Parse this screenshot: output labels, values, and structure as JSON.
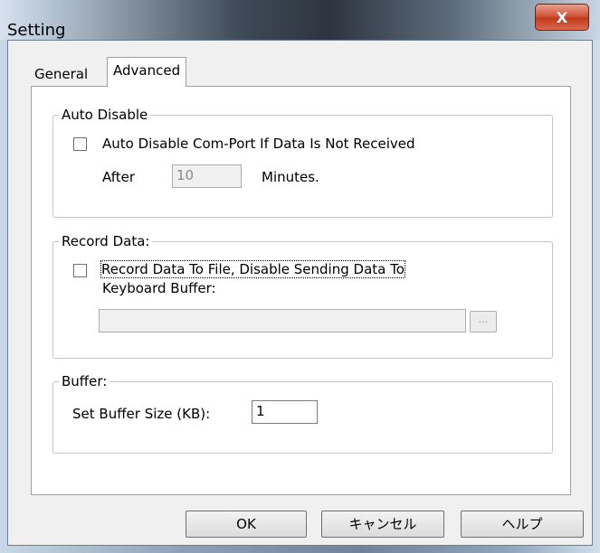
{
  "window": {
    "title": "Setting",
    "close_label": "X"
  },
  "tabs": [
    {
      "label": "General"
    },
    {
      "label": "Advanced"
    }
  ],
  "auto_disable": {
    "legend": "Auto Disable",
    "checkbox_label": "Auto Disable Com-Port If Data Is Not Received",
    "after_label": "After",
    "minutes_value": "10",
    "minutes_label": "Minutes."
  },
  "record_data": {
    "legend": "Record Data:",
    "checkbox_label_line1": "Record Data To File, Disable Sending Data To",
    "checkbox_label_line2": "Keyboard Buffer:",
    "file_path_value": "",
    "browse_label": "..."
  },
  "buffer": {
    "legend": "Buffer:",
    "size_label": "Set Buffer Size (KB):",
    "size_value": "1"
  },
  "buttons": {
    "ok": "OK",
    "cancel": "キャンセル",
    "help": "ヘルプ"
  }
}
